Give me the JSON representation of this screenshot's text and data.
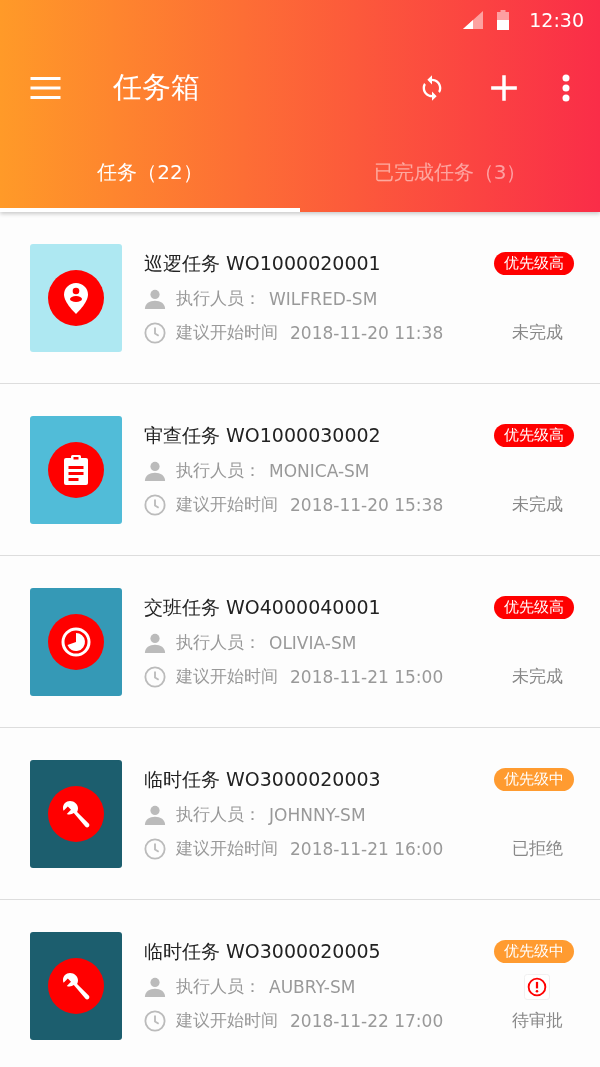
{
  "status_bar": {
    "time": "12:30"
  },
  "toolbar": {
    "title": "任务箱"
  },
  "tabs": [
    {
      "label": "任务（22）",
      "selected": true
    },
    {
      "label": "已完成任务（3）",
      "selected": false
    }
  ],
  "tasks": [
    {
      "kind": "patrol",
      "color": "#aee8f2",
      "title": "巡逻任务 WO1000020001",
      "priority": {
        "label": "优先级高",
        "kind": "high"
      },
      "assignee_label": "执行人员：",
      "assignee": "WILFRED-SM",
      "time_label": "建议开始时间",
      "time": "2018-11-20 11:38",
      "status": "未完成",
      "alert": false
    },
    {
      "kind": "review",
      "color": "#51bcd8",
      "title": "审查任务 WO1000030002",
      "priority": {
        "label": "优先级高",
        "kind": "high"
      },
      "assignee_label": "执行人员：",
      "assignee": "MONICA-SM",
      "time_label": "建议开始时间",
      "time": "2018-11-20 15:38",
      "status": "未完成",
      "alert": false
    },
    {
      "kind": "handover",
      "color": "#3599b6",
      "title": "交班任务 WO4000040001",
      "priority": {
        "label": "优先级高",
        "kind": "high"
      },
      "assignee_label": "执行人员：",
      "assignee": "OLIVIA-SM",
      "time_label": "建议开始时间",
      "time": "2018-11-21 15:00",
      "status": "未完成",
      "alert": false
    },
    {
      "kind": "temporary",
      "color": "#1c5e6e",
      "title": "临时任务 WO3000020003",
      "priority": {
        "label": "优先级中",
        "kind": "medium"
      },
      "assignee_label": "执行人员：",
      "assignee": "JOHNNY-SM",
      "time_label": "建议开始时间",
      "time": "2018-11-21 16:00",
      "status": "已拒绝",
      "alert": false
    },
    {
      "kind": "temporary",
      "color": "#1c5e6e",
      "title": "临时任务 WO3000020005",
      "priority": {
        "label": "优先级中",
        "kind": "medium"
      },
      "assignee_label": "执行人员：",
      "assignee": "AUBRY-SM",
      "time_label": "建议开始时间",
      "time": "2018-11-22 17:00",
      "status": "待审批",
      "alert": true
    }
  ]
}
